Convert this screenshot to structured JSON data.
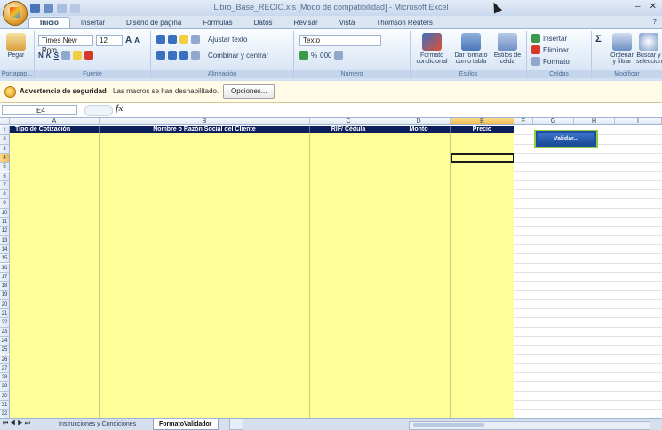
{
  "window": {
    "title": "Libro_Base_RECIO.xls  [Modo de compatibilidad] - Microsoft Excel",
    "controls": [
      "–",
      "▫",
      "✕"
    ]
  },
  "ribbon_tabs": [
    "Inicio",
    "Insertar",
    "Diseño de página",
    "Fórmulas",
    "Datos",
    "Revisar",
    "Vista",
    "Thomson Reuters"
  ],
  "active_tab": "Inicio",
  "ribbon": {
    "clipboard": {
      "paste": "Pegar",
      "label": "Portapap..."
    },
    "font": {
      "name": "Times New Rom",
      "size": "12",
      "label": "Fuente",
      "bold": "N",
      "italic": "K",
      "underline": "S",
      "grow": "A",
      "shrink": "A"
    },
    "alignment": {
      "wrap": "Ajustar texto",
      "merge": "Combinar y centrar",
      "label": "Alineación"
    },
    "number": {
      "format": "Texto",
      "percent": "%",
      "thousands": "000",
      "label": "Número"
    },
    "styles": {
      "conditional": "Formato condicional",
      "table": "Dar formato como tabla",
      "cell": "Estilos de celda",
      "label": "Estilos"
    },
    "cells": {
      "insert": "Insertar",
      "delete": "Eliminar",
      "format": "Formato",
      "label": "Celdas"
    },
    "editing": {
      "sort": "Ordenar y filtrar",
      "find": "Buscar y seleccionar",
      "sigma": "Σ",
      "label": "Modificar"
    }
  },
  "security": {
    "title": "Advertencia de seguridad",
    "message": "Las macros se han deshabilitado.",
    "options_button": "Opciones..."
  },
  "formula_bar": {
    "cell_ref": "E4",
    "fx": "fx",
    "value": ""
  },
  "columns": [
    "A",
    "B",
    "C",
    "D",
    "E",
    "F",
    "G",
    "H",
    "I"
  ],
  "selected_column": "E",
  "selected_row": 4,
  "rows": [
    "1",
    "2",
    "3",
    "4",
    "5",
    "6",
    "7",
    "8",
    "9",
    "10",
    "11",
    "12",
    "13",
    "14",
    "15",
    "16",
    "17",
    "18",
    "19",
    "20",
    "21",
    "22",
    "23",
    "24",
    "25",
    "26",
    "27",
    "28",
    "29",
    "30",
    "31",
    "32"
  ],
  "table_headers": [
    "Tipo de Cotización",
    "Nombre o Razón Social del Cliente",
    "RIF/ Cédula",
    "Monto",
    "Precio"
  ],
  "validate_button": "Validar...",
  "sheets": [
    "Instrucciones y Condiciones",
    "FormatoValidador"
  ],
  "active_sheet": "FormatoValidador",
  "colors": {
    "header_fill": "#0b1f5c",
    "input_fill": "#ffff99",
    "button_border": "#8fce40"
  }
}
